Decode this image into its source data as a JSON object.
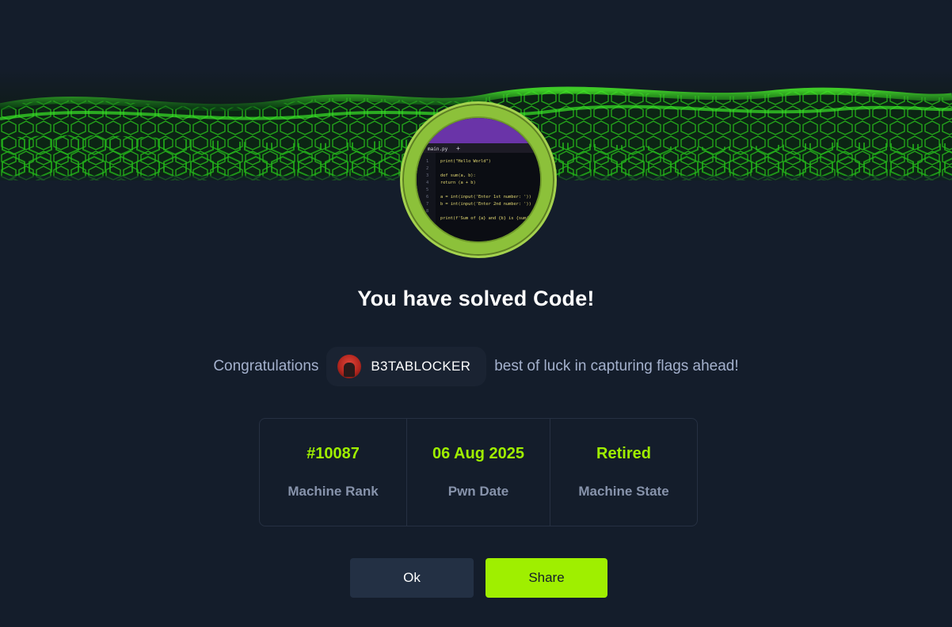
{
  "modal": {
    "title": "You have solved Code!",
    "congrats_prefix": "Congratulations",
    "congrats_suffix": "best of luck in capturing flags ahead!",
    "user": {
      "name": "B3TABLOCKER",
      "avatar_icon": "user-avatar-icon"
    },
    "machine_avatar_icon": "code-editor-icon",
    "stats": [
      {
        "value": "#10087",
        "label": "Machine Rank"
      },
      {
        "value": "06 Aug 2025",
        "label": "Pwn Date"
      },
      {
        "value": "Retired",
        "label": "Machine State"
      }
    ],
    "buttons": {
      "ok": "Ok",
      "share": "Share"
    },
    "code_lines": [
      "print(\"Hello World\")",
      "",
      "def sum(a, b):",
      "    return (a + b)",
      "",
      "a = int(input('Enter 1st number: '))",
      "b = int(input('Enter 2nd number: '))",
      "",
      "print(f'Sum of {a} and {b} is {sum(a,"
    ],
    "code_tab": "main.py"
  },
  "colors": {
    "accent": "#9fef00",
    "background": "#141d2b",
    "ring": "#8cc13a"
  }
}
